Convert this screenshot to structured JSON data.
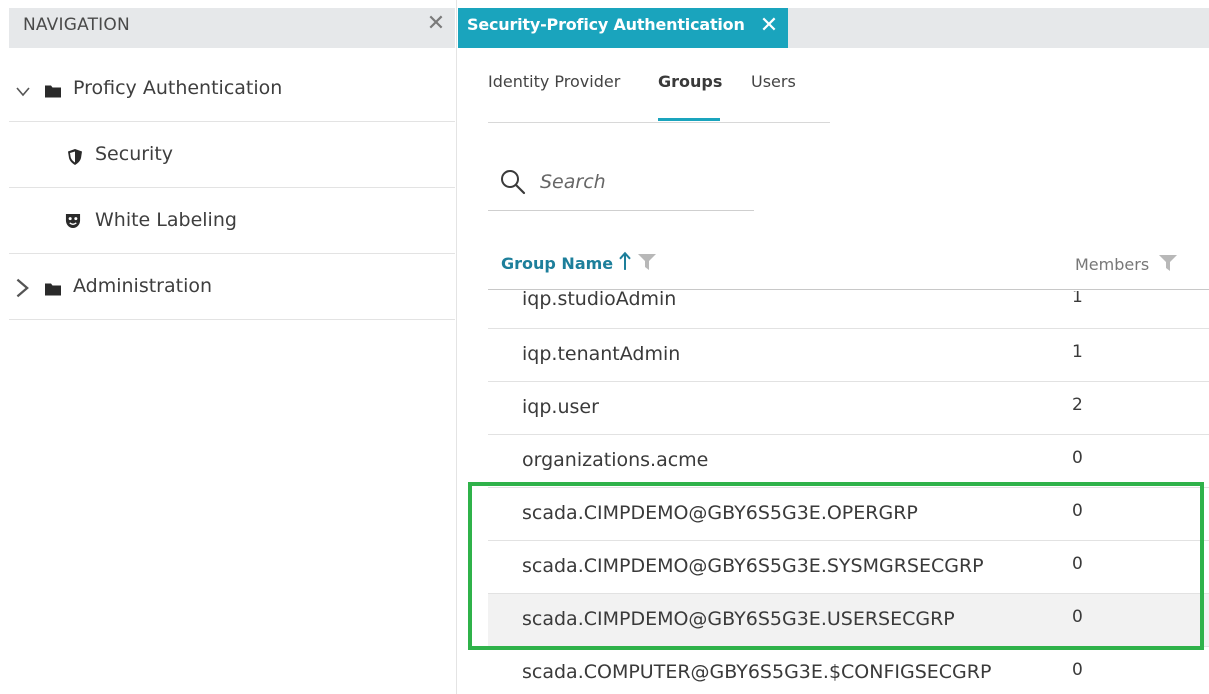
{
  "navigation": {
    "title": "NAVIGATION",
    "close_glyph": "✕",
    "items": [
      {
        "label": "Proficy Authentication",
        "expanded": true,
        "icon": "folder-icon"
      },
      {
        "label": "Security",
        "icon": "shield-icon"
      },
      {
        "label": "White Labeling",
        "icon": "mask-icon"
      },
      {
        "label": "Administration",
        "expanded": false,
        "icon": "folder-icon"
      }
    ]
  },
  "document_tab": {
    "label": "Security-Proficy Authentication",
    "close_glyph": "✕",
    "color": "#1aa4bd"
  },
  "sub_tabs": [
    {
      "label": "Identity Provider",
      "active": false
    },
    {
      "label": "Groups",
      "active": true
    },
    {
      "label": "Users",
      "active": false
    }
  ],
  "search": {
    "placeholder": "Search"
  },
  "grid": {
    "columns": {
      "name": "Group Name",
      "members": "Members"
    },
    "sort": "ascending",
    "rows": [
      {
        "name": "iqp.studioAdmin",
        "members": "1"
      },
      {
        "name": "iqp.tenantAdmin",
        "members": "1"
      },
      {
        "name": "iqp.user",
        "members": "2"
      },
      {
        "name": "organizations.acme",
        "members": "0"
      },
      {
        "name": "scada.CIMPDEMO@GBY6S5G3E.OPERGRP",
        "members": "0"
      },
      {
        "name": "scada.CIMPDEMO@GBY6S5G3E.SYSMGRSECGRP",
        "members": "0"
      },
      {
        "name": "scada.CIMPDEMO@GBY6S5G3E.USERSECGRP",
        "members": "0"
      },
      {
        "name": "scada.COMPUTER@GBY6S5G3E.$CONFIGSECGRP",
        "members": "0"
      }
    ]
  },
  "colors": {
    "accent": "#1aa4bd",
    "highlight": "#2fb24a"
  }
}
